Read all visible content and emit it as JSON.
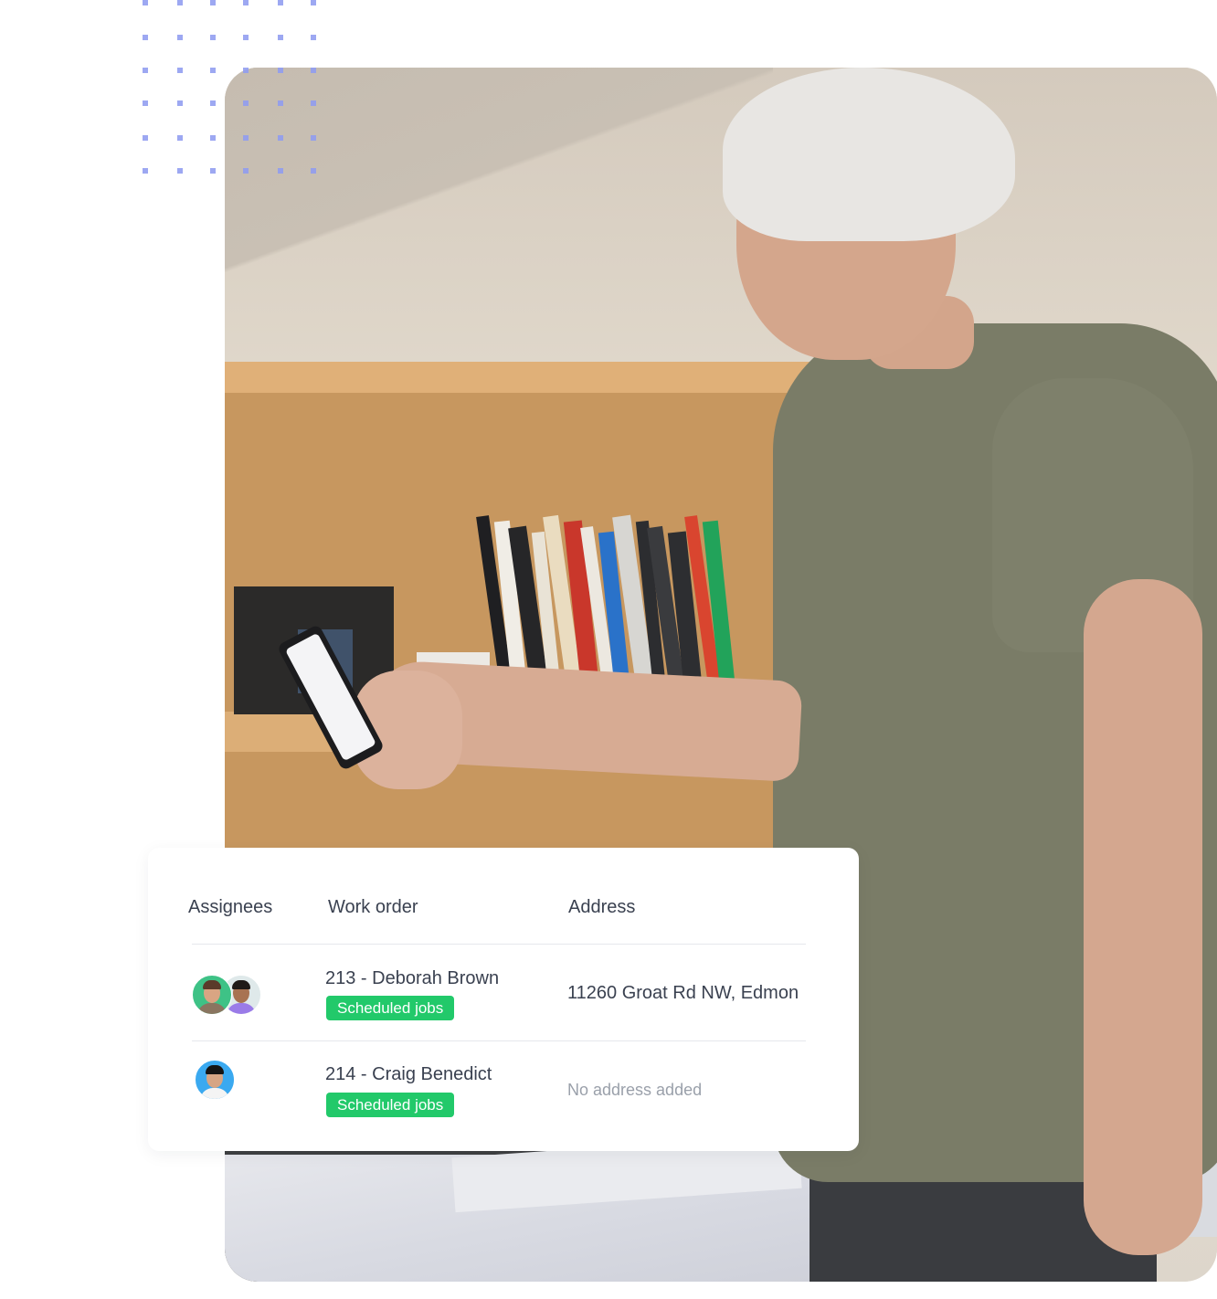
{
  "theme": {
    "dot_color": "#8f9cf0",
    "badge_color": "#22c96a",
    "text_color": "#3a4150",
    "muted_text_color": "#9aa0aa"
  },
  "photo": {
    "description": "Man with grey hair in olive t-shirt looking at a smartphone in front of a wooden bookshelf"
  },
  "table": {
    "columns": [
      "Assignees",
      "Work order",
      "Address"
    ],
    "rows": [
      {
        "assignees": [
          "avatar-woman-green",
          "avatar-man-purple"
        ],
        "work_order": "213 - Deborah Brown",
        "status": "Scheduled jobs",
        "address": "11260 Groat Rd NW, Edmon"
      },
      {
        "assignees": [
          "avatar-man-blue"
        ],
        "work_order": "214 - Craig Benedict",
        "status": "Scheduled jobs",
        "address": "No address added"
      }
    ]
  }
}
